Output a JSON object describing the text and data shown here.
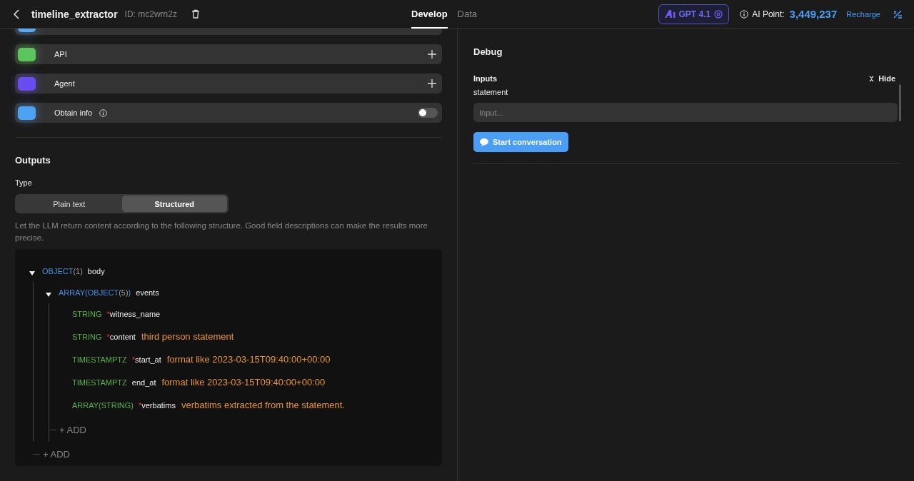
{
  "header": {
    "title": "timeline_extractor",
    "id": "ID: mc2wrn2z",
    "tabs": [
      {
        "label": "Develop",
        "selected": true
      },
      {
        "label": "Data",
        "selected": false
      }
    ],
    "model": "GPT 4.1",
    "points_label": "AI Point:",
    "points": "3,449,237",
    "recharge": "Recharge"
  },
  "plugins": [
    {
      "kind": "partial",
      "color": "#5ba8f2"
    },
    {
      "kind": "add",
      "label": "API",
      "color": "#5cc45c"
    },
    {
      "kind": "add",
      "label": "Agent",
      "color": "#6a4cf0"
    },
    {
      "kind": "toggle",
      "label": "Obtain info",
      "color": "#4ea2f2",
      "info": true,
      "on": false
    }
  ],
  "outputs": {
    "title": "Outputs",
    "type_label": "Type",
    "types": [
      {
        "label": "Plain text",
        "selected": false
      },
      {
        "label": "Structured",
        "selected": true
      }
    ],
    "description": "Let the LLM return content according to the following structure. Good field descriptions can make the results more precise.",
    "required_mark": "*",
    "schema": [
      {
        "kind": "object",
        "type": "OBJECT",
        "count": "(1)",
        "name": "body",
        "required": false,
        "expanded": true,
        "add": "+ ADD",
        "children": [
          {
            "kind": "object",
            "type": "ARRAY(OBJECT",
            "count": "(5)",
            "suffix": ")",
            "name": "events",
            "required": false,
            "expanded": true,
            "add": "+ ADD",
            "children": [
              {
                "kind": "scalar",
                "type": "STRING",
                "name": "witness_name",
                "required": true
              },
              {
                "kind": "scalar",
                "type": "STRING",
                "name": "content",
                "required": true,
                "description": "third person statement"
              },
              {
                "kind": "scalar",
                "type": "TIMESTAMPTZ",
                "name": "start_at",
                "required": true,
                "description": "format like 2023-03-15T09:40:00+00:00"
              },
              {
                "kind": "scalar",
                "type": "TIMESTAMPTZ",
                "name": "end_at",
                "required": false,
                "description": "format like 2023-03-15T09:40:00+00:00"
              },
              {
                "kind": "scalar",
                "type": "ARRAY(STRING)",
                "name": "verbatims",
                "required": true,
                "description": "verbatims extracted from the statement."
              }
            ]
          }
        ]
      }
    ]
  },
  "debug": {
    "title": "Debug",
    "inputs_label": "Inputs",
    "hide": "Hide",
    "field_label": "statement",
    "placeholder": "Input...",
    "start": "Start conversation"
  }
}
